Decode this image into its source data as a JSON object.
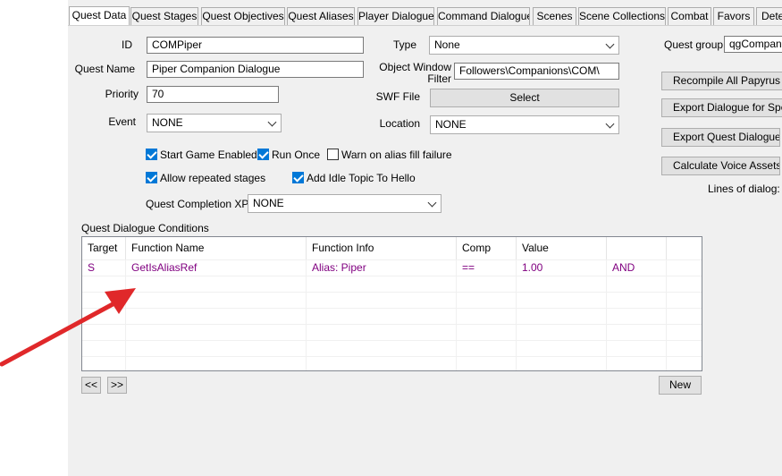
{
  "tabs": [
    "Quest Data",
    "Quest Stages",
    "Quest Objectives",
    "Quest Aliases",
    "Player Dialogue",
    "Command Dialogue",
    "Scenes",
    "Scene Collections",
    "Combat",
    "Favors",
    "Dete"
  ],
  "fields": {
    "id_label": "ID",
    "id_value": "COMPiper",
    "quest_name_label": "Quest Name",
    "quest_name_value": "Piper Companion Dialogue",
    "priority_label": "Priority",
    "priority_value": "70",
    "event_label": "Event",
    "event_value": "NONE",
    "type_label": "Type",
    "type_value": "None",
    "owf_label_1": "Object Window",
    "owf_label_2": "Filter",
    "owf_value": "Followers\\Companions\\COM\\",
    "swf_label": "SWF File",
    "swf_button": "Select",
    "location_label": "Location",
    "location_value": "NONE",
    "quest_group_label": "Quest group",
    "quest_group_value": "qgCompanio",
    "completion_xp_label": "Quest Completion XP",
    "completion_xp_value": "NONE"
  },
  "checkboxes": {
    "start_game_enabled": {
      "label": "Start Game Enabled",
      "checked": true
    },
    "run_once": {
      "label": "Run Once",
      "checked": true
    },
    "warn_alias": {
      "label": "Warn on alias fill failure",
      "checked": false
    },
    "allow_repeated": {
      "label": "Allow repeated stages",
      "checked": true
    },
    "add_idle": {
      "label": "Add Idle Topic To Hello",
      "checked": true
    }
  },
  "right_buttons": {
    "recompile": "Recompile All Papyrus Sc",
    "export_specific": "Export Dialogue for Speci",
    "export_quest": "Export Quest Dialogue",
    "calc_voice": "Calculate Voice Assets",
    "lines_of_dialog": "Lines of dialog:"
  },
  "conditions": {
    "title": "Quest Dialogue Conditions",
    "headers": [
      "Target",
      "Function Name",
      "Function Info",
      "Comp",
      "Value",
      ""
    ],
    "rows": [
      [
        "S",
        "GetIsAliasRef",
        "Alias: Piper",
        "==",
        "1.00",
        "AND"
      ]
    ],
    "prev_button": "<<",
    "next_button": ">>",
    "new_button": "New"
  },
  "colors": {
    "condition_text": "#800080",
    "checkbox_on": "#0078d7",
    "arrow": "#e0282a"
  }
}
